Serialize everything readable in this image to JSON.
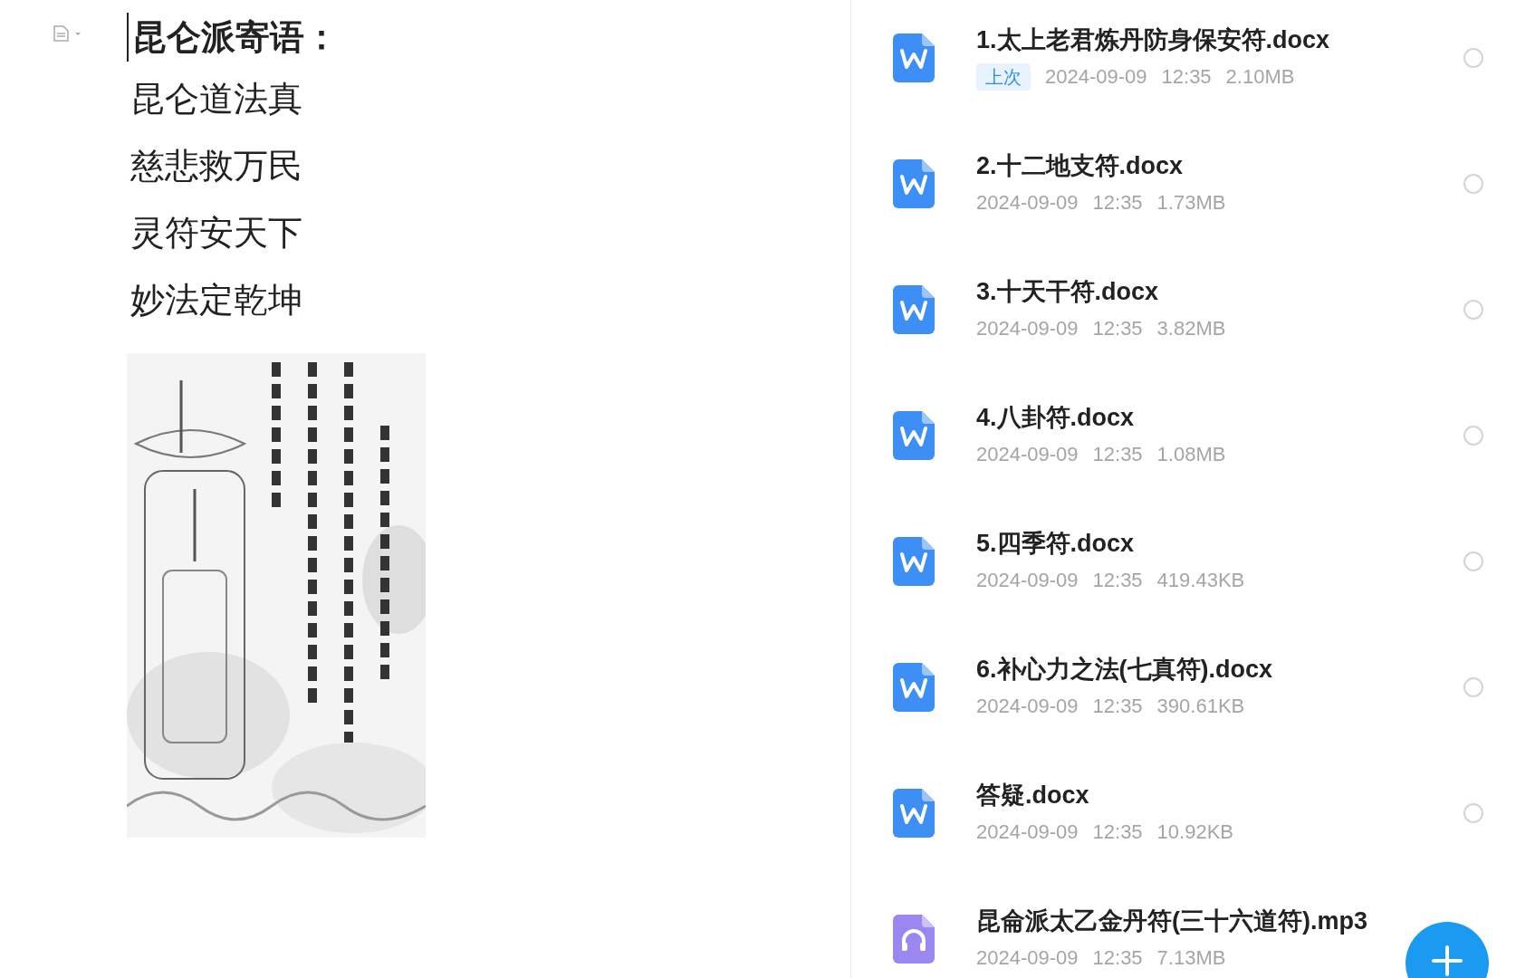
{
  "document": {
    "heading": "昆仑派寄语：",
    "lines": [
      "昆仑道法真",
      "慈悲救万民",
      "灵符安天下",
      "妙法定乾坤"
    ]
  },
  "files": [
    {
      "kind": "doc",
      "name": "1.太上老君炼丹防身保安符.docx",
      "badge": "上次",
      "date": "2024-09-09",
      "time": "12:35",
      "size": "2.10MB",
      "selected": false
    },
    {
      "kind": "doc",
      "name": "2.十二地支符.docx",
      "date": "2024-09-09",
      "time": "12:35",
      "size": "1.73MB",
      "selected": false
    },
    {
      "kind": "doc",
      "name": "3.十天干符.docx",
      "date": "2024-09-09",
      "time": "12:35",
      "size": "3.82MB",
      "selected": false
    },
    {
      "kind": "doc",
      "name": "4.八卦符.docx",
      "date": "2024-09-09",
      "time": "12:35",
      "size": "1.08MB",
      "selected": false
    },
    {
      "kind": "doc",
      "name": "5.四季符.docx",
      "date": "2024-09-09",
      "time": "12:35",
      "size": "419.43KB",
      "selected": false
    },
    {
      "kind": "doc",
      "name": "6.补心力之法(七真符).docx",
      "date": "2024-09-09",
      "time": "12:35",
      "size": "390.61KB",
      "selected": false
    },
    {
      "kind": "doc",
      "name": "答疑.docx",
      "date": "2024-09-09",
      "time": "12:35",
      "size": "10.92KB",
      "selected": false
    },
    {
      "kind": "audio",
      "name": "昆侖派太乙金丹符(三十六道符).mp3",
      "date": "2024-09-09",
      "time": "12:35",
      "size": "7.13MB"
    }
  ]
}
